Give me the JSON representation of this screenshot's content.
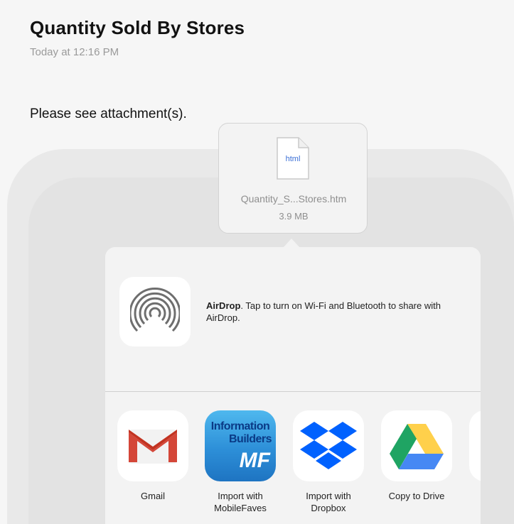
{
  "email": {
    "subject": "Quantity Sold By Stores",
    "timestamp": "Today at 12:16 PM",
    "body": "Please see attachment(s)."
  },
  "attachment": {
    "file_type": "html",
    "file_name": "Quantity_S...Stores.htm",
    "file_size": "3.9 MB"
  },
  "share_sheet": {
    "airdrop": {
      "title": "AirDrop",
      "description": ". Tap to turn on Wi-Fi and Bluetooth to share with AirDrop."
    },
    "apps": [
      {
        "label": "Gmail",
        "icon": "gmail-icon"
      },
      {
        "label": "Import with MobileFaves",
        "icon": "mobilefaves-icon"
      },
      {
        "label": "Import with Dropbox",
        "icon": "dropbox-icon"
      },
      {
        "label": "Copy to Drive",
        "icon": "google-drive-icon"
      }
    ],
    "mobilefaves_logo": {
      "line1": "Information",
      "line2": "Builders",
      "line3": "MF"
    }
  },
  "colors": {
    "gmail_red": "#d44638",
    "dropbox_blue": "#0061fe",
    "drive_green": "#1fa463",
    "drive_yellow": "#ffd04b",
    "drive_blue": "#4688f4",
    "file_ext_blue": "#3b6fd6"
  }
}
